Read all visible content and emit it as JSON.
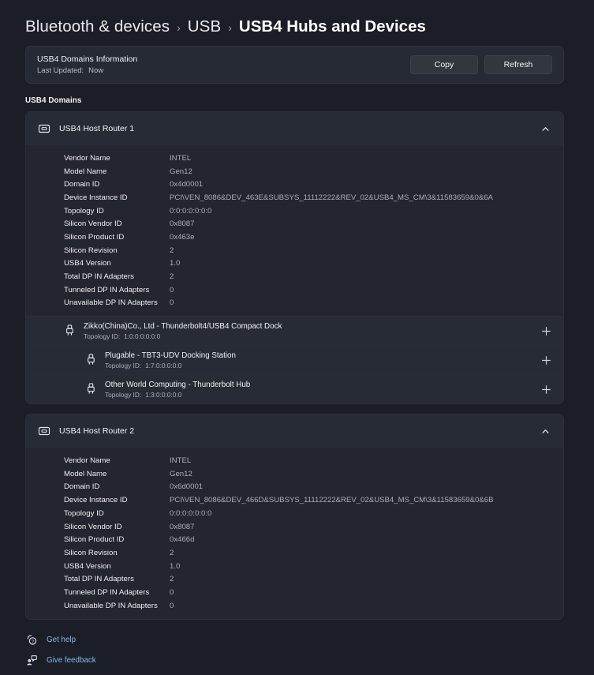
{
  "breadcrumb": {
    "items": [
      {
        "label": "Bluetooth & devices",
        "current": false
      },
      {
        "label": "USB",
        "current": false
      },
      {
        "label": "USB4 Hubs and Devices",
        "current": true
      }
    ],
    "separator": "›"
  },
  "info_card": {
    "title": "USB4 Domains Information",
    "last_updated_label": "Last Updated:",
    "last_updated_value": "Now",
    "copy_label": "Copy",
    "refresh_label": "Refresh"
  },
  "section": {
    "label": "USB4 Domains"
  },
  "property_keys": [
    "Vendor Name",
    "Model Name",
    "Domain ID",
    "Device Instance ID",
    "Topology ID",
    "Silicon Vendor ID",
    "Silicon Product ID",
    "Silicon Revision",
    "USB4 Version",
    "Total DP IN Adapters",
    "Tunneled DP IN Adapters",
    "Unavailable DP IN Adapters"
  ],
  "routers": [
    {
      "title": "USB4 Host Router 1",
      "expanded": true,
      "chevron": "˄",
      "properties": [
        "INTEL",
        "Gen12",
        "0x4d0001",
        "PCI\\VEN_8086&DEV_463E&SUBSYS_11112222&REV_02&USB4_MS_CM\\3&11583659&0&6A",
        "0:0:0:0:0:0:0",
        "0x8087",
        "0x463e",
        "2",
        "1.0",
        "2",
        "0",
        "0"
      ],
      "devices": [
        {
          "name": "Zikko(China)Co., Ltd - Thunderbolt4/USB4 Compact Dock",
          "topology_label": "Topology ID:",
          "topology_value": "1:0:0:0:0:0:0",
          "level": 1,
          "expand": "+"
        },
        {
          "name": "Plugable - TBT3-UDV Docking Station",
          "topology_label": "Topology ID:",
          "topology_value": "1:7:0:0:0:0:0",
          "level": 2,
          "expand": "+"
        },
        {
          "name": "Other World Computing - Thunderbolt Hub",
          "topology_label": "Topology ID:",
          "topology_value": "1:3:0:0:0:0:0",
          "level": 2,
          "expand": "+"
        }
      ]
    },
    {
      "title": "USB4 Host Router 2",
      "expanded": true,
      "chevron": "˄",
      "properties": [
        "INTEL",
        "Gen12",
        "0x6d0001",
        "PCI\\VEN_8086&DEV_466D&SUBSYS_11112222&REV_02&USB4_MS_CM\\3&11583659&0&6B",
        "0:0:0:0:0:0:0",
        "0x8087",
        "0x466d",
        "2",
        "1.0",
        "2",
        "0",
        "0"
      ],
      "devices": []
    }
  ],
  "footer": {
    "links": [
      {
        "label": "Get help",
        "icon": "help-icon"
      },
      {
        "label": "Give feedback",
        "icon": "feedback-icon"
      }
    ]
  },
  "colors": {
    "page_background": "#1b1e27",
    "card_header": "#272b35",
    "card_body": "#23262f",
    "accent_link": "#85b9e8",
    "value_text": "#a9aeb8"
  }
}
